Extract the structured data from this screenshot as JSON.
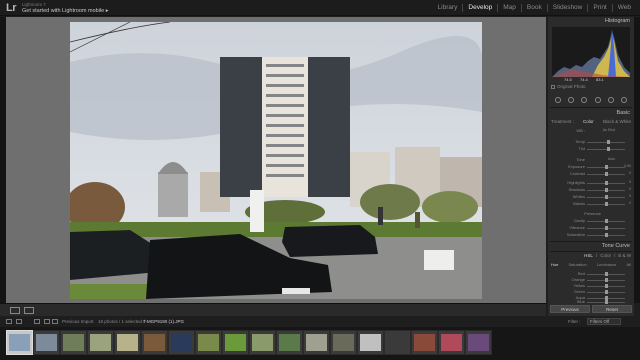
{
  "app": {
    "logo": "Lr",
    "identity_line1": "Lightroom 7",
    "identity_line2": "Get started with Lightroom mobile ▸"
  },
  "modules": [
    "Library",
    "Develop",
    "Map",
    "Book",
    "Slideshow",
    "Print",
    "Web"
  ],
  "active_module": "Develop",
  "right_panel": {
    "histogram_title": "Histogram",
    "histogram_readout": [
      "74.5",
      "74.4",
      "83.1"
    ],
    "original_photo_label": "Original Photo",
    "basic_title": "Basic",
    "treatment_tabs": [
      "Treatment :",
      "Color",
      "Black & White"
    ],
    "wb_label": "WB :",
    "wb_value": "As Shot",
    "wb_sliders": [
      "Temp",
      "Tint"
    ],
    "tone_label": "Tone",
    "tone_auto": "Auto",
    "tone_sliders": [
      {
        "label": "Exposure",
        "value": "0.00"
      },
      {
        "label": "Contrast",
        "value": "0"
      },
      {
        "label": "Highlights",
        "value": "0"
      },
      {
        "label": "Shadows",
        "value": "0"
      },
      {
        "label": "Whites",
        "value": "0"
      },
      {
        "label": "Blacks",
        "value": "0"
      }
    ],
    "presence_label": "Presence",
    "presence_sliders": [
      "Clarity",
      "Vibrance",
      "Saturation"
    ],
    "tone_curve_title": "Tone Curve",
    "hsl_tabs": [
      "HSL",
      "/",
      "Color",
      "/",
      "B & W"
    ],
    "hsl_subtabs": [
      "Hue",
      "Saturation",
      "Luminance",
      "All"
    ],
    "hsl_rows": [
      "Red",
      "Orange",
      "Yellow",
      "Green",
      "Aqua",
      "Blue"
    ],
    "previous_button": "Previous",
    "reset_button": "Reset"
  },
  "filmstrip": {
    "nav_label": "Previous Import",
    "selection_info": "18 photos / 1 selected /",
    "file_name": "T-MGP9190 (1).JPG",
    "filter_label": "Filter :",
    "filter_value": "Filters Off",
    "thumb_colors": [
      "#8aa0b8",
      "#7c8a99",
      "#6f7d5a",
      "#9aa27e",
      "#b7b28a",
      "#7a5a3a",
      "#2a3a5a",
      "#7a8a4a",
      "#6a9a3a",
      "#8a9a6a",
      "#5a7a4a",
      "#a0a090",
      "#6a6a5a",
      "#c0c0c0",
      "#3a3a3a",
      "#8a4a3a",
      "#b04a5a",
      "#6a4a7a"
    ]
  },
  "colors": {
    "accent": "#e6e6e6",
    "panel_bg": "#2b2b2b",
    "canvas_bg": "#6f6f6f"
  }
}
